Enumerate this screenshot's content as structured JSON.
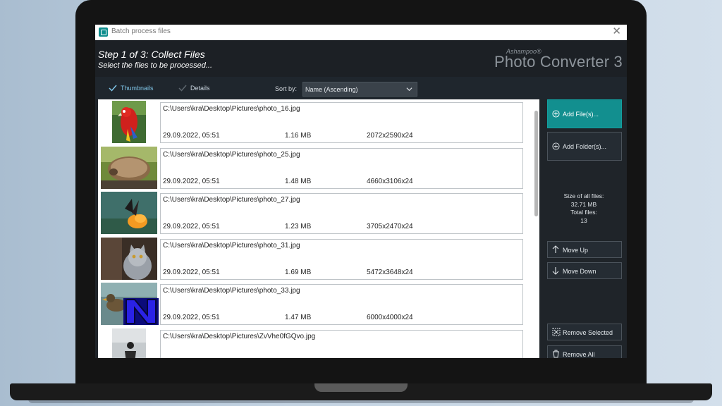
{
  "window": {
    "title": "Batch process files"
  },
  "header": {
    "step": "Step 1 of 3: Collect Files",
    "subtitle": "Select the files to be processed...",
    "brand_small": "Ashampoo®",
    "brand_big": "Photo Converter 3"
  },
  "toolbar": {
    "tab_thumbnails": "Thumbnails",
    "tab_details": "Details",
    "sort_label": "Sort by:",
    "sort_value": "Name (Ascending)"
  },
  "files": [
    {
      "path": "C:\\Users\\kra\\Desktop\\Pictures\\photo_16.jpg",
      "date": "29.09.2022, 05:51",
      "size": "1.16 MB",
      "dims": "2072x2590x24",
      "thumb": "parrot"
    },
    {
      "path": "C:\\Users\\kra\\Desktop\\Pictures\\photo_25.jpg",
      "date": "29.09.2022, 05:51",
      "size": "1.48 MB",
      "dims": "4660x3106x24",
      "thumb": "hedgehog"
    },
    {
      "path": "C:\\Users\\kra\\Desktop\\Pictures\\photo_27.jpg",
      "date": "29.09.2022, 05:51",
      "size": "1.23 MB",
      "dims": "3705x2470x24",
      "thumb": "butterfly"
    },
    {
      "path": "C:\\Users\\kra\\Desktop\\Pictures\\photo_31.jpg",
      "date": "29.09.2022, 05:51",
      "size": "1.69 MB",
      "dims": "5472x3648x24",
      "thumb": "cat"
    },
    {
      "path": "C:\\Users\\kra\\Desktop\\Pictures\\photo_33.jpg",
      "date": "29.09.2022, 05:51",
      "size": "1.47 MB",
      "dims": "6000x4000x24",
      "thumb": "duck"
    },
    {
      "path": "C:\\Users\\kra\\Desktop\\Pictures\\ZvVhe0fGQvo.jpg",
      "date": "",
      "size": "",
      "dims": "",
      "thumb": "person"
    }
  ],
  "panel": {
    "add_files": "Add File(s)...",
    "add_folder": "Add Folder(s)...",
    "size_label": "Size of all files:",
    "size_value": "32.71 MB",
    "total_label": "Total files:",
    "total_value": "13",
    "move_up": "Move Up",
    "move_down": "Move Down",
    "remove_selected": "Remove Selected",
    "remove_all": "Remove All"
  },
  "colors": {
    "accent": "#128f8f",
    "panel": "#1f2429"
  }
}
